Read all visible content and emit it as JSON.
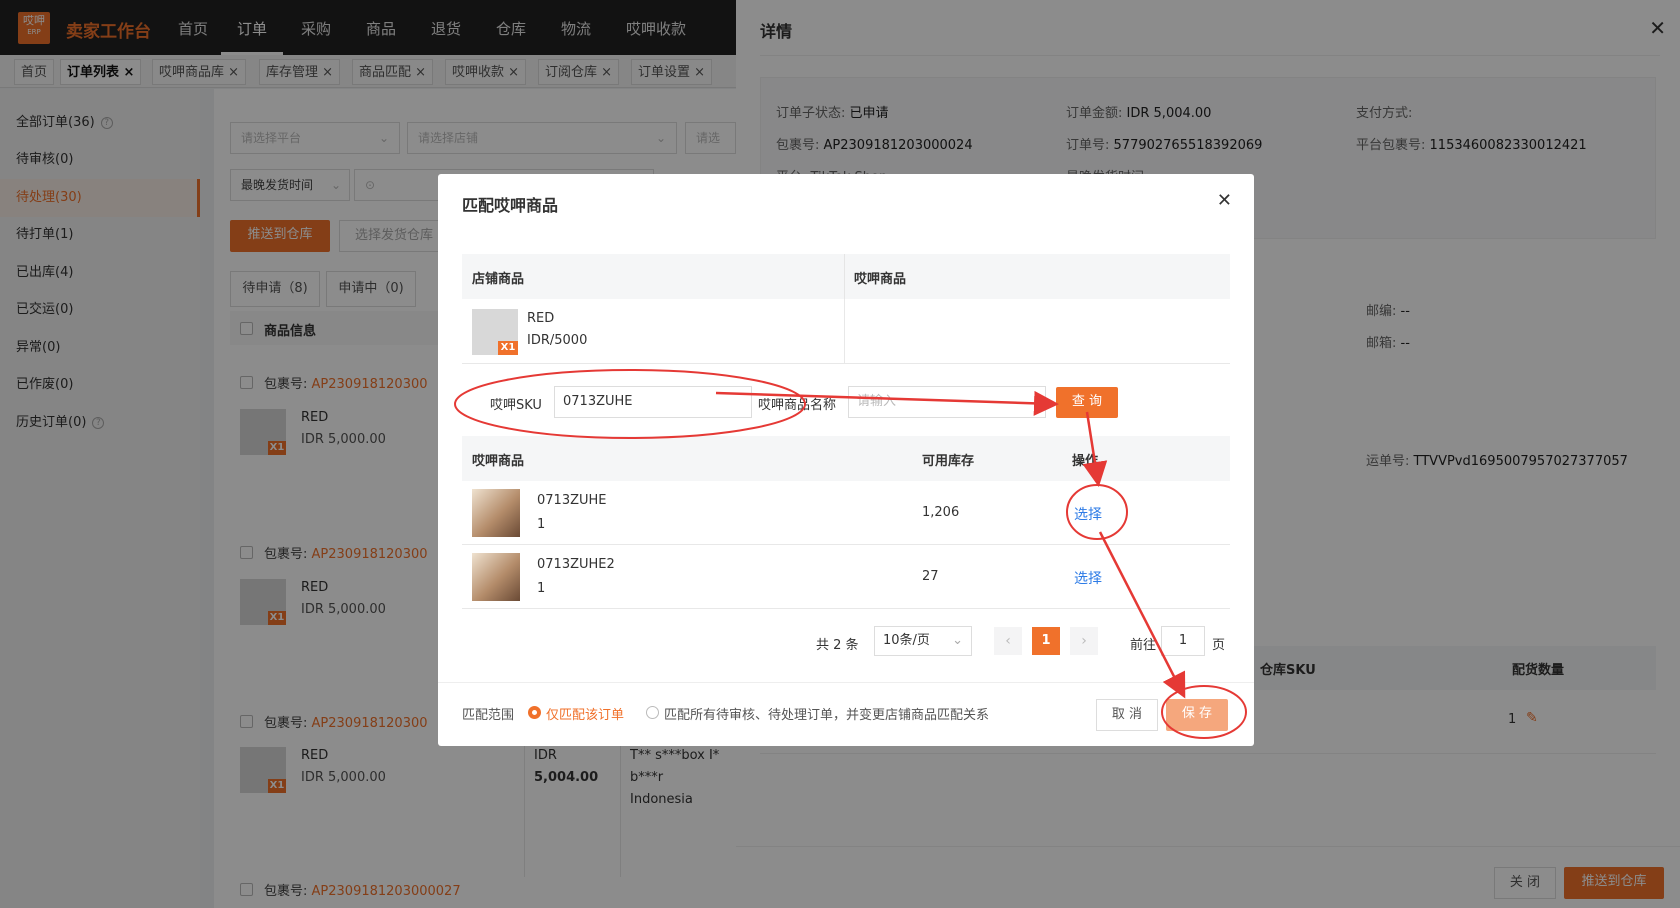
{
  "topnav": {
    "logo_text": "哎呷",
    "logo_sub": "ERP",
    "brand": "卖家工作台",
    "items": [
      "首页",
      "订单",
      "采购",
      "商品",
      "退货",
      "仓库",
      "物流",
      "哎呷收款"
    ],
    "active": 1
  },
  "tabs": [
    {
      "label": "首页"
    },
    {
      "label": "订单列表",
      "active": true
    },
    {
      "label": "哎呷商品库"
    },
    {
      "label": "库存管理"
    },
    {
      "label": "商品匹配"
    },
    {
      "label": "哎呷收款"
    },
    {
      "label": "订阅仓库"
    },
    {
      "label": "订单设置"
    }
  ],
  "sidebar": {
    "items": [
      "全部订单(36)",
      "待审核(0)",
      "待处理(30)",
      "待打单(1)",
      "已出库(4)",
      "已交运(0)",
      "异常(0)",
      "已作废(0)",
      "历史订单(0)"
    ],
    "active": 2
  },
  "main": {
    "filter_platform": "请选择平台",
    "filter_store": "请选择店铺",
    "filter_more": "请选",
    "time_select": "最晚发货时间",
    "push_btn": "推送到仓库",
    "select_wh_btn": "选择发货仓库",
    "subtabs": [
      "待申请（8)",
      "申请中（0)"
    ],
    "col_product": "商品信息",
    "pkg_label": "包裹号:",
    "packages": [
      {
        "no": "AP230918120300",
        "name": "RED",
        "price": "IDR 5,000.00"
      },
      {
        "no": "AP230918120300",
        "name": "RED",
        "price": "IDR 5,000.00"
      },
      {
        "no": "AP230918120300",
        "name": "RED",
        "price": "IDR 5,000.00",
        "amount_label": "IDR",
        "amount": "5,004.00",
        "addr1": "T** s***box I*",
        "addr2": "b***r",
        "addr3": "Indonesia"
      },
      {
        "no": "AP2309181203000027"
      }
    ],
    "qty_badge": "X1"
  },
  "drawer": {
    "title": "详情",
    "sub_status_label": "订单子状态:",
    "sub_status": "已申请",
    "amount_label": "订单金额:",
    "amount": "IDR 5,004.00",
    "pay_label": "支付方式:",
    "pkg_label": "包裹号:",
    "pkg": "AP2309181203000024",
    "order_label": "订单号:",
    "order": "577902765518392069",
    "platform_pkg_label": "平台包裹号:",
    "platform_pkg": "1153460082330012421",
    "platform_row": "平台: TikTok Shop",
    "latest_ship_row": "最晚发货时间:",
    "zip_label": "邮编:",
    "zip": "--",
    "email_label": "邮箱:",
    "email": "--",
    "waybill_label": "运单号:",
    "waybill": "TTVVPvd1695007957027377057",
    "col_wh_sku": "仓库SKU",
    "col_qty": "配货数量",
    "qty": "1",
    "close_btn": "关 闭",
    "push_btn": "推送到仓库"
  },
  "modal": {
    "title": "匹配哎呷商品",
    "col_store": "店铺商品",
    "col_aiya": "哎呷商品",
    "store_item": {
      "name": "RED",
      "price": "IDR/5000",
      "badge": "X1"
    },
    "sku_label": "哎呷SKU",
    "sku_value": "0713ZUHE",
    "name_label": "哎呷商品名称",
    "name_placeholder": "请输入",
    "query_btn": "查 询",
    "res_col_product": "哎呷商品",
    "res_col_stock": "可用库存",
    "res_col_op": "操作",
    "results": [
      {
        "sku": "0713ZUHE",
        "qty": "1",
        "stock": "1,206",
        "action": "选择"
      },
      {
        "sku": "0713ZUHE2",
        "qty": "1",
        "stock": "27",
        "action": "选择"
      }
    ],
    "total": "共 2 条",
    "page_size": "10条/页",
    "current_page": "1",
    "goto_label": "前往",
    "goto_value": "1",
    "page_unit": "页",
    "scope_label": "匹配范围",
    "scope_opt1": "仅匹配该订单",
    "scope_opt2": "匹配所有待审核、待处理订单，并变更店铺商品匹配关系",
    "cancel_btn": "取 消",
    "save_btn": "保 存"
  }
}
